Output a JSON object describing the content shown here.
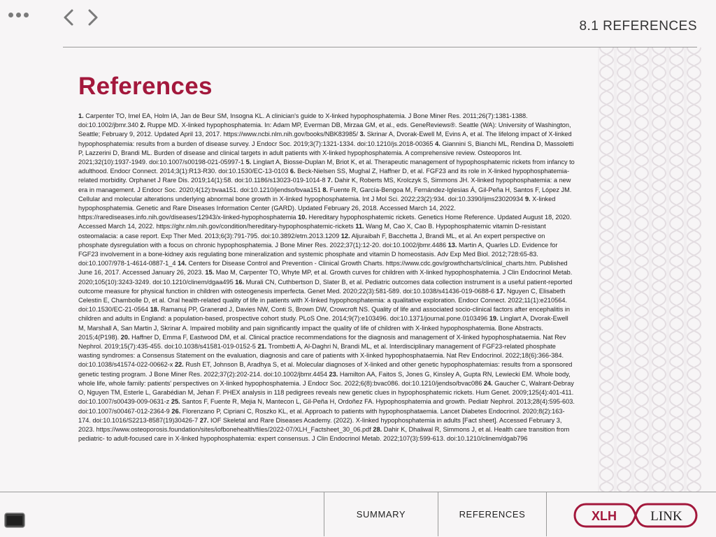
{
  "header": {
    "section_title": "8.1 REFERENCES"
  },
  "main": {
    "heading": "References",
    "references": [
      {
        "n": "1.",
        "text": "Carpenter TO, Imel EA, Holm IA, Jan de Beur SM, Insogna KL. A clinician's guide to X-linked hypophosphatemia. J Bone Miner Res. 2011;26(7):1381-1388. doi:10.1002/jbmr.340"
      },
      {
        "n": "2.",
        "text": "Ruppe MD. X-linked hypophosphatemia. In: Adam MP, Everman DB, Mirzaa GM, et al., eds. GeneReviews®. Seattle (WA): University of Washington, Seattle; February 9, 2012. Updated April 13, 2017. https://www.ncbi.nlm.nih.gov/books/NBK83985/"
      },
      {
        "n": "3.",
        "text": "Skrinar A, Dvorak-Ewell M, Evins A, et al. The lifelong impact of X-linked hypophosphatemia: results from a burden of disease survey. J Endocr Soc. 2019;3(7):1321-1334. doi:10.1210/js.2018-00365"
      },
      {
        "n": "4.",
        "text": "Giannini S, Bianchi ML, Rendina D, Massoletti P, Lazzerini D, Brandi ML. Burden of disease and clinical targets in adult patients with X-linked hypophosphatemia. A comprehensive review. Osteoporos Int. 2021;32(10):1937-1949. doi:10.1007/s00198-021-05997-1"
      },
      {
        "n": "5.",
        "text": "Linglart A, Biosse-Duplan M, Briot K, et al. Therapeutic management of hypophosphatemic rickets from infancy to adulthood. Endocr Connect. 2014;3(1):R13-R30. doi:10.1530/EC-13-0103"
      },
      {
        "n": "6.",
        "text": "Beck-Nielsen SS, Mughal Z, Haffner D, et al. FGF23 and its role in X-linked hypophosphatemia-related morbidity. Orphanet J Rare Dis. 2019;14(1):58. doi:10.1186/s13023-019-1014-8"
      },
      {
        "n": "7.",
        "text": "Dahir K, Roberts MS, Krolczyk S, Simmons JH. X-linked hypophosphatemia: a new era in management. J Endocr Soc. 2020;4(12):bvaa151. doi:10.1210/jendso/bvaa151"
      },
      {
        "n": "8.",
        "text": "Fuente R, García-Bengoa M, Fernández-Iglesias Á, Gil-Peña H, Santos F, López JM. Cellular and molecular alterations underlying abnormal bone growth in X-linked hypophosphatemia. Int J Mol Sci. 2022;23(2):934. doi:10.3390/ijms23020934"
      },
      {
        "n": "9.",
        "text": "X-linked hypophosphatemia. Genetic and Rare Diseases Information Center (GARD). Updated February 26, 2018. Accessed March 14, 2022. https://rarediseases.info.nih.gov/diseases/12943/x-linked-hypophosphatemia"
      },
      {
        "n": "10.",
        "text": "Hereditary hypophosphatemic rickets. Genetics Home Reference. Updated August 18, 2020. Accessed March 14, 2022. https://ghr.nlm.nih.gov/condition/hereditary-hypophosphatemic-rickets"
      },
      {
        "n": "11.",
        "text": "Wang M, Cao X, Cao B. Hypophosphatemic vitamin D-resistant osteomalacia: a case report. Exp Ther Med. 2013;6(3):791-795. doi:10.3892/etm.2013.1209"
      },
      {
        "n": "12.",
        "text": "Aljuraibah F, Bacchetta J, Brandi ML, et al. An expert perspective on phosphate dysregulation with a focus on chronic hypophosphatemia. J Bone Miner Res. 2022;37(1):12-20. doi:10.1002/jbmr.4486"
      },
      {
        "n": "13.",
        "text": "Martin A, Quarles LD. Evidence for FGF23 involvement in a bone-kidney axis regulating bone mineralization and systemic phosphate and vitamin D homeostasis. Adv Exp Med Biol. 2012;728:65-83. doi:10.1007/978-1-4614-0887-1_4"
      },
      {
        "n": "14.",
        "text": "Centers for Disease Control and Prevention - Clinical Growth Charts. https://www.cdc.gov/growthcharts/clinical_charts.htm. Published June 16, 2017. Accessed January 26, 2023."
      },
      {
        "n": "15.",
        "text": "Mao M, Carpenter TO, Whyte MP, et al. Growth curves for children with X-linked hypophosphatemia. J Clin Endocrinol Metab. 2020;105(10):3243-3249. doi:10.1210/clinem/dgaa495"
      },
      {
        "n": "16.",
        "text": "Murali CN, Cuthbertson D, Slater B, et al. Pediatric outcomes data collection instrument is a useful patient-reported outcome measure for physical function in children with osteogenesis imperfecta. Genet Med. 2020;22(3):581-589. doi:10.1038/s41436-019-0688-6"
      },
      {
        "n": "17.",
        "text": "Nguyen C, Elisabeth Celestin E, Chambolle D, et al. Oral health-related quality of life in patients with X-linked hypophosphatemia: a qualitative exploration. Endocr Connect. 2022;11(1):e210564. doi:10.1530/EC-21-0564"
      },
      {
        "n": "18.",
        "text": "Ramanuj PP, Granerød J, Davies NW, Conti S, Brown DW, Crowcroft NS. Quality of life and associated socio-clinical factors after encephalitis in children and adults in England: a population-based, prospective cohort study. PLoS One. 2014;9(7):e103496. doi:10.1371/journal.pone.0103496"
      },
      {
        "n": "19.",
        "text": "Linglart A, Dvorak-Ewell M, Marshall A, San Martin J, Skrinar A. Impaired mobility and pain significantly impact the quality of life of children with X-linked hypophosphatemia. Bone Abstracts. 2015;4(P198)."
      },
      {
        "n": "20.",
        "text": "Haffner D, Emma F, Eastwood DM, et al. Clinical practice recommendations for the diagnosis and management of X-linked hypophosphataemia. Nat Rev Nephrol. 2019;15(7):435-455. doi:10.1038/s41581-019-0152-5"
      },
      {
        "n": "21.",
        "text": "Trombetti A, Al-Daghri N, Brandi ML, et al. Interdisciplinary management of FGF23-related phosphate wasting syndromes: a Consensus Statement on the evaluation, diagnosis and care of patients with X-linked hypophosphataemia. Nat Rev Endocrinol. 2022;18(6):366-384. doi:10.1038/s41574-022-00662-x"
      },
      {
        "n": "22.",
        "text": "Rush ET, Johnson B, Aradhya S, et al. Molecular diagnoses of X-linked and other genetic hypophosphatemias: results from a sponsored genetic testing program. J Bone Miner Res. 2022;37(2):202-214. doi:10.1002/jbmr.4454"
      },
      {
        "n": "23.",
        "text": "Hamilton AA, Faitos S, Jones G, Kinsley A, Gupta RN, Lewiecki EM. Whole body, whole life, whole family: patients' perspectives on X-linked hypophosphatemia. J Endocr Soc. 2022;6(8):bvac086. doi:10.1210/jendso/bvac086"
      },
      {
        "n": "24.",
        "text": "Gaucher C, Walrant-Debray O, Nguyen TM, Esterle L, Garabédian M, Jehan F. PHEX analysis in 118 pedigrees reveals new genetic clues in hypophosphatemic rickets. Hum Genet. 2009;125(4):401-411. doi:10.1007/s00439-009-0631-z"
      },
      {
        "n": "25.",
        "text": "Santos F, Fuente R, Mejia N, Mantecon L, Gil-Peña H, Ordoñez FA. Hypophosphatemia and growth. Pediatr Nephrol. 2013;28(4):595-603. doi:10.1007/s00467-012-2364-9"
      },
      {
        "n": "26.",
        "text": "Florenzano P, Cipriani C, Roszko KL, et al. Approach to patients with hypophosphataemia. Lancet Diabetes Endocrinol. 2020;8(2):163-174. doi:10.1016/S2213-8587(19)30426-7"
      },
      {
        "n": "27.",
        "text": "IOF Skeletal and Rare Diseases Academy. (2022). X-linked hypophosphatemia in adults [Fact sheet]. Accessed February 3, 2023. https://www.osteoporosis.foundation/sites/iofbonehealth/files/2022-07/XLH_Factsheet_30_06.pdf"
      },
      {
        "n": "28.",
        "text": "Dahir K, Dhaliwal R, Simmons J, et al. Health care transition from pediatric- to adult-focused care in X-linked hypophosphatemia: expert consensus. J Clin Endocrinol Metab. 2022;107(3):599-613. doi:10.1210/clinem/dgab796"
      }
    ]
  },
  "footer": {
    "summary_label": "SUMMARY",
    "references_label": "REFERENCES",
    "logo_left": "XLH",
    "logo_right": "LINK"
  },
  "colors": {
    "accent": "#a3183c",
    "background": "#f7f5f6",
    "rule": "#9a9a9a"
  },
  "icons": {
    "menu": "more-dots-icon",
    "back": "chevron-left-icon",
    "forward": "chevron-right-icon",
    "screen": "screen-icon"
  }
}
